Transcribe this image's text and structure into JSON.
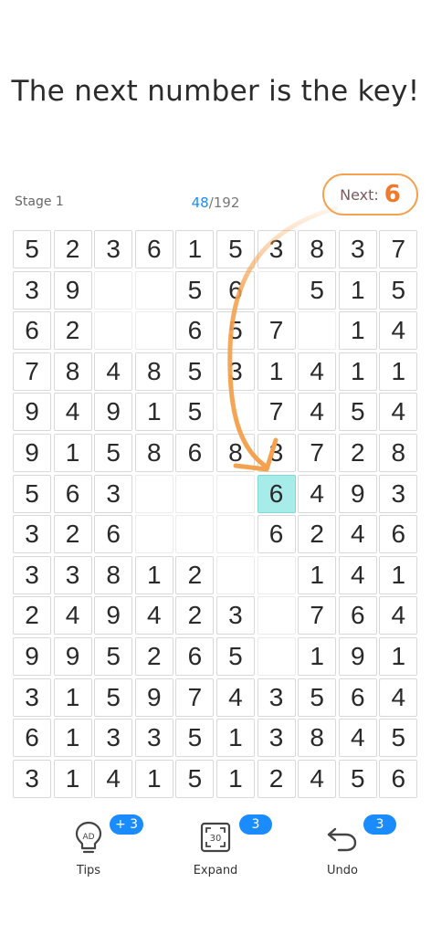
{
  "headline": "The next number is the key!",
  "stage": "Stage 1",
  "progress": {
    "done": "48",
    "total": "/192"
  },
  "next": {
    "label": "Next:",
    "value": "6"
  },
  "accent_color": "#1a8cff",
  "highlight_color": "#a8ecea",
  "arrow_color": "#f4a24f",
  "grid": [
    [
      "5",
      "2",
      "3",
      "6",
      "1",
      "5",
      "3",
      "8",
      "3",
      "7"
    ],
    [
      "3",
      "9",
      "",
      "",
      "5",
      "6",
      "",
      "5",
      "1",
      "5"
    ],
    [
      "6",
      "2",
      "",
      "",
      "6",
      "5",
      "7",
      "",
      "1",
      "4"
    ],
    [
      "7",
      "8",
      "4",
      "8",
      "5",
      "3",
      "1",
      "4",
      "1",
      "1"
    ],
    [
      "9",
      "4",
      "9",
      "1",
      "5",
      "",
      "7",
      "4",
      "5",
      "4"
    ],
    [
      "9",
      "1",
      "5",
      "8",
      "6",
      "8",
      "3",
      "7",
      "2",
      "8"
    ],
    [
      "5",
      "6",
      "3",
      "",
      "",
      "",
      "6",
      "4",
      "9",
      "3"
    ],
    [
      "3",
      "2",
      "6",
      "",
      "",
      "",
      "6",
      "2",
      "4",
      "6"
    ],
    [
      "3",
      "3",
      "8",
      "1",
      "2",
      "",
      "",
      "1",
      "4",
      "1"
    ],
    [
      "2",
      "4",
      "9",
      "4",
      "2",
      "3",
      "",
      "7",
      "6",
      "4"
    ],
    [
      "9",
      "9",
      "5",
      "2",
      "6",
      "5",
      "",
      "1",
      "9",
      "1"
    ],
    [
      "3",
      "1",
      "5",
      "9",
      "7",
      "4",
      "3",
      "5",
      "6",
      "4"
    ],
    [
      "6",
      "1",
      "3",
      "3",
      "5",
      "1",
      "3",
      "8",
      "4",
      "5"
    ],
    [
      "3",
      "1",
      "4",
      "1",
      "5",
      "1",
      "2",
      "4",
      "5",
      "6"
    ]
  ],
  "highlight_cell": {
    "row": 6,
    "col": 6
  },
  "toolbar": {
    "tips": {
      "label": "Tips",
      "badge": "+ 3",
      "icon": "lightbulb-ad-icon",
      "icon_text": "AD"
    },
    "expand": {
      "label": "Expand",
      "badge": "3",
      "icon": "expand-icon",
      "icon_text": "30"
    },
    "undo": {
      "label": "Undo",
      "badge": "3",
      "icon": "undo-icon"
    }
  }
}
